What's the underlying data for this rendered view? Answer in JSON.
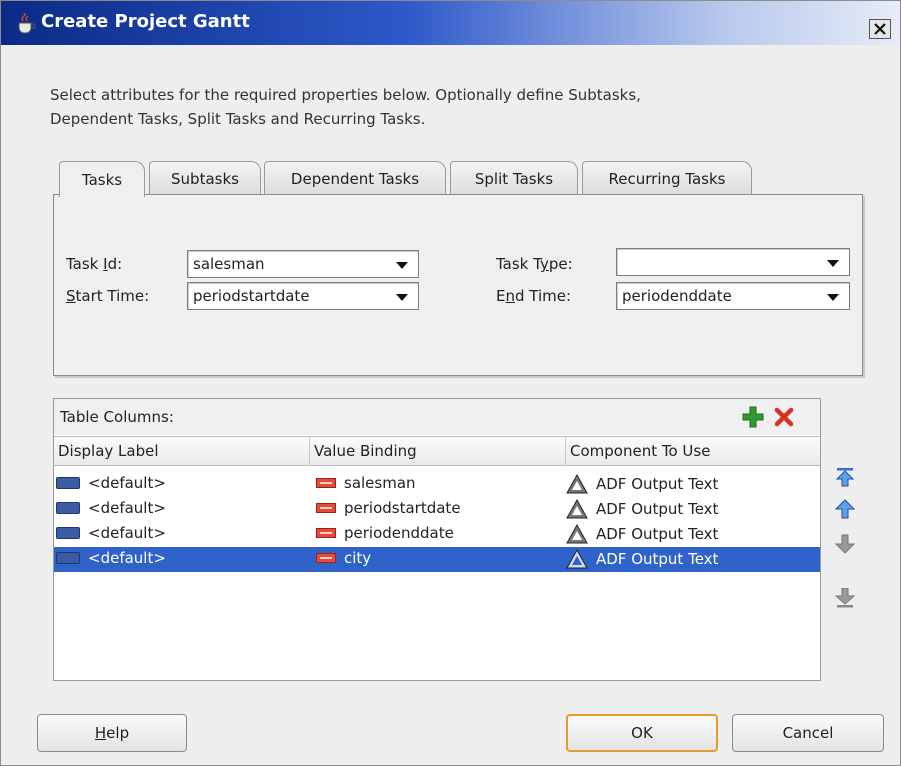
{
  "window": {
    "title": "Create Project Gantt",
    "close_label": "X"
  },
  "instructions": {
    "line1": "Select attributes for the required properties below.  Optionally define Subtasks,",
    "line2": "Dependent Tasks, Split Tasks and Recurring Tasks."
  },
  "tabs": [
    {
      "label": "Tasks",
      "active": true
    },
    {
      "label": "Subtasks",
      "active": false
    },
    {
      "label": "Dependent Tasks",
      "active": false
    },
    {
      "label": "Split Tasks",
      "active": false
    },
    {
      "label": "Recurring Tasks",
      "active": false
    }
  ],
  "fields": {
    "task_id": {
      "label_pre": "Task ",
      "label_mnemonic": "I",
      "label_post": "d:",
      "value": "salesman"
    },
    "start_time": {
      "label_pre": "",
      "label_mnemonic": "S",
      "label_post": "tart Time:",
      "value": "periodstartdate"
    },
    "task_type": {
      "label_pre": "Task T",
      "label_mnemonic": "y",
      "label_post": "pe:",
      "value": ""
    },
    "end_time": {
      "label_pre": "E",
      "label_mnemonic": "n",
      "label_post": "d Time:",
      "value": "periodenddate"
    }
  },
  "table_columns": {
    "title": "Table Columns:",
    "headers": [
      "Display Label",
      "Value Binding",
      "Component To Use"
    ],
    "rows": [
      {
        "display_label": "<default>",
        "value_binding": "salesman",
        "component": "ADF Output Text",
        "selected": false
      },
      {
        "display_label": "<default>",
        "value_binding": "periodstartdate",
        "component": "ADF Output Text",
        "selected": false
      },
      {
        "display_label": "<default>",
        "value_binding": "periodenddate",
        "component": "ADF Output Text",
        "selected": false
      },
      {
        "display_label": "<default>",
        "value_binding": "city",
        "component": "ADF Output Text",
        "selected": true
      }
    ]
  },
  "icons": {
    "window": "java-cup-icon",
    "add": "plus-icon",
    "delete": "x-icon",
    "row_label": "xml-node-icon",
    "row_binding": "attribute-icon",
    "row_component": "adf-component-icon",
    "move_top": "move-top-icon",
    "move_up": "move-up-icon",
    "move_down": "move-down-icon",
    "move_bottom": "move-bottom-icon"
  },
  "colors": {
    "title_bar": "#0a2a86",
    "selection": "#3063c9",
    "add_icon": "#2f9a2f",
    "delete_icon": "#d93222",
    "default_button_border": "#e59b2c"
  },
  "buttons": {
    "help_mnemonic": "H",
    "help_rest": "elp",
    "ok": "OK",
    "cancel": "Cancel"
  }
}
